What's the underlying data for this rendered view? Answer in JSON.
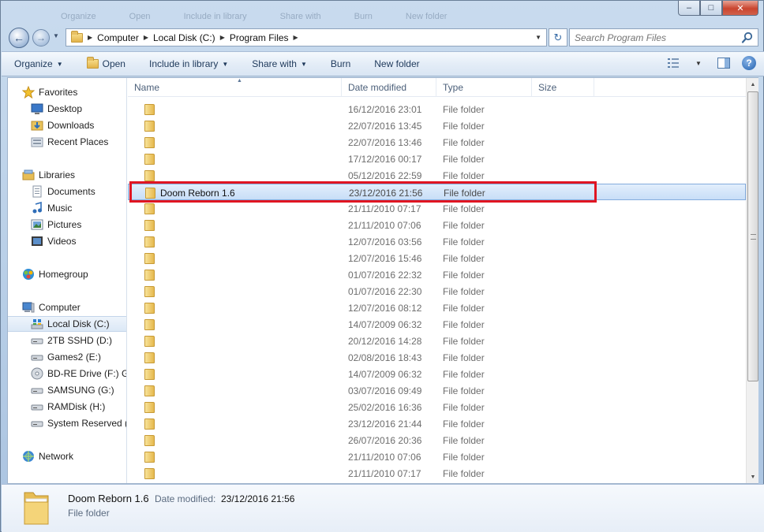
{
  "window": {
    "ghost_toolbar": [
      "Organize",
      "Open",
      "Include in library",
      "Share with",
      "Burn",
      "New folder"
    ],
    "caption": {
      "minimize": "–",
      "maximize": "□",
      "close": "✕"
    }
  },
  "address": {
    "crumbs": [
      "Computer",
      "Local Disk (C:)",
      "Program Files"
    ],
    "search_placeholder": "Search Program Files"
  },
  "toolbar": {
    "organize": "Organize",
    "open": "Open",
    "include_in_library": "Include in library",
    "share_with": "Share with",
    "burn": "Burn",
    "new_folder": "New folder",
    "help": "?"
  },
  "sidebar": {
    "favorites": {
      "label": "Favorites",
      "items": [
        "Desktop",
        "Downloads",
        "Recent Places"
      ]
    },
    "libraries": {
      "label": "Libraries",
      "items": [
        "Documents",
        "Music",
        "Pictures",
        "Videos"
      ]
    },
    "homegroup": "Homegroup",
    "computer": {
      "label": "Computer",
      "items": [
        "Local Disk (C:)",
        "2TB SSHD  (D:)",
        "Games2 (E:)",
        "BD-RE Drive (F:) GH",
        "SAMSUNG (G:)",
        "RAMDisk (H:)",
        "System Reserved (I"
      ]
    },
    "network": "Network"
  },
  "columns": {
    "name": "Name",
    "date": "Date modified",
    "type": "Type",
    "size": "Size"
  },
  "files": [
    {
      "name": "",
      "date": "16/12/2016 23:01",
      "type": "File folder"
    },
    {
      "name": "",
      "date": "22/07/2016 13:45",
      "type": "File folder"
    },
    {
      "name": "",
      "date": "22/07/2016 13:46",
      "type": "File folder"
    },
    {
      "name": "",
      "date": "17/12/2016 00:17",
      "type": "File folder"
    },
    {
      "name": "",
      "date": "05/12/2016 22:59",
      "type": "File folder"
    },
    {
      "name": "Doom Reborn 1.6",
      "date": "23/12/2016 21:56",
      "type": "File folder",
      "selected": true
    },
    {
      "name": "",
      "date": "21/11/2010 07:17",
      "type": "File folder"
    },
    {
      "name": "",
      "date": "21/11/2010 07:06",
      "type": "File folder"
    },
    {
      "name": "",
      "date": "12/07/2016 03:56",
      "type": "File folder"
    },
    {
      "name": "",
      "date": "12/07/2016 15:46",
      "type": "File folder"
    },
    {
      "name": "",
      "date": "01/07/2016 22:32",
      "type": "File folder"
    },
    {
      "name": "",
      "date": "01/07/2016 22:30",
      "type": "File folder"
    },
    {
      "name": "",
      "date": "12/07/2016 08:12",
      "type": "File folder"
    },
    {
      "name": "",
      "date": "14/07/2009 06:32",
      "type": "File folder"
    },
    {
      "name": "",
      "date": "20/12/2016 14:28",
      "type": "File folder"
    },
    {
      "name": "",
      "date": "02/08/2016 18:43",
      "type": "File folder"
    },
    {
      "name": "",
      "date": "14/07/2009 06:32",
      "type": "File folder"
    },
    {
      "name": "",
      "date": "03/07/2016 09:49",
      "type": "File folder"
    },
    {
      "name": "",
      "date": "25/02/2016 16:36",
      "type": "File folder"
    },
    {
      "name": "",
      "date": "23/12/2016 21:44",
      "type": "File folder"
    },
    {
      "name": "",
      "date": "26/07/2016 20:36",
      "type": "File folder"
    },
    {
      "name": "",
      "date": "21/11/2010 07:06",
      "type": "File folder"
    },
    {
      "name": "",
      "date": "21/11/2010 07:17",
      "type": "File folder"
    }
  ],
  "details": {
    "name": "Doom Reborn 1.6",
    "modified_label": "Date modified:",
    "modified_value": "23/12/2016 21:56",
    "type": "File folder"
  },
  "highlight_color": "#e01522"
}
